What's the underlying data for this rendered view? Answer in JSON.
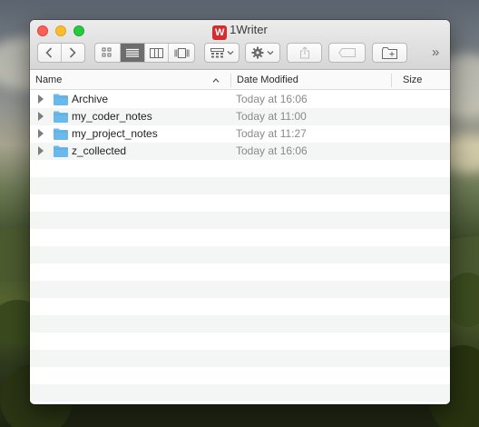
{
  "window": {
    "title": "1Writer",
    "app_badge": "W"
  },
  "toolbar": {
    "back_label": "‹",
    "forward_label": "›",
    "more_label": "»"
  },
  "columns": {
    "name": "Name",
    "date_modified": "Date Modified",
    "size": "Size"
  },
  "files": [
    {
      "name": "Archive",
      "date": "Today at 16:06"
    },
    {
      "name": "my_coder_notes",
      "date": "Today at 11:00"
    },
    {
      "name": "my_project_notes",
      "date": "Today at 11:27"
    },
    {
      "name": "z_collected",
      "date": "Today at 16:06"
    }
  ],
  "colors": {
    "folder": "#69b9ec",
    "close": "#fc5f57",
    "minimize": "#fdbc2e",
    "maximize": "#28c840",
    "active_view": "#6d6d6d",
    "badge": "#d42d2d"
  }
}
